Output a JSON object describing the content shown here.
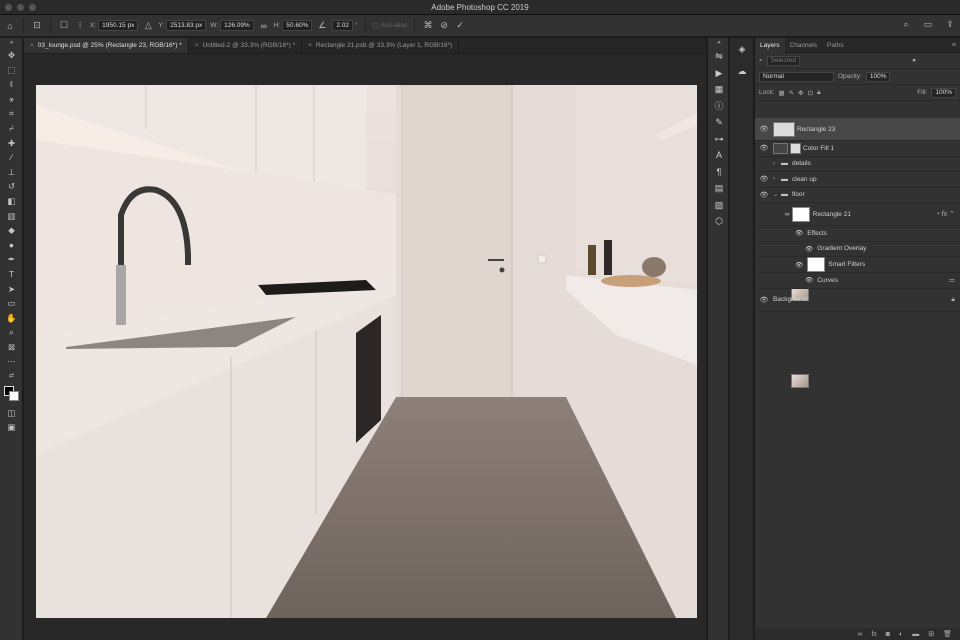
{
  "app": {
    "title": "Adobe Photoshop CC 2019"
  },
  "options": {
    "x_label": "X:",
    "x_value": "1950.15 px",
    "y_label": "Y:",
    "y_value": "2513.83 px",
    "w_label": "W:",
    "w_value": "126.09%",
    "h_label": "H:",
    "h_value": "50.60%",
    "angle_value": "2.02",
    "degree": "°",
    "antialias_label": "Anti-alias"
  },
  "tabs": [
    {
      "label": "03_lounge.psd @ 25% (Rectangle 23, RGB/16*) *",
      "active": true
    },
    {
      "label": "Untitled-2 @ 33.3% (RGB/16*) *",
      "active": false
    },
    {
      "label": "Rectangle 21.psb @ 33.3% (Layer 1, RGB/16*)",
      "active": false
    }
  ],
  "panel": {
    "tabs": [
      "Layers",
      "Channels",
      "Paths"
    ],
    "filter_value": "Selected",
    "blend_mode": "Normal",
    "opacity_label": "Opacity:",
    "opacity_value": "100%",
    "lock_label": "Lock:",
    "fill_label": "Fill:",
    "fill_value": "100%"
  },
  "layers": [
    {
      "name": "Rectangle 23"
    },
    {
      "name": "Color Fill 1"
    },
    {
      "name": "details"
    },
    {
      "name": "clean up"
    },
    {
      "name": "floor"
    },
    {
      "name": "Rectangle 21"
    },
    {
      "name": "Effects"
    },
    {
      "name": "Gradient Overlay"
    },
    {
      "name": "Smart Filters"
    },
    {
      "name": "Curves"
    },
    {
      "name": "Background"
    }
  ]
}
